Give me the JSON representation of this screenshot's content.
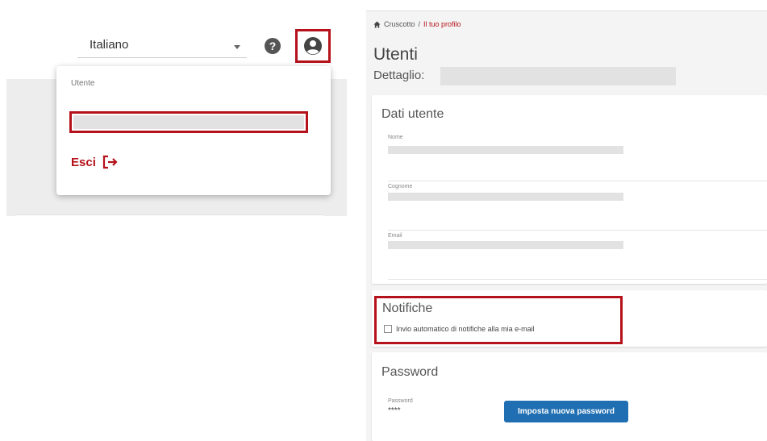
{
  "header": {
    "language": "Italiano",
    "help_icon": "question-circle-icon",
    "user_icon": "user-circle-icon"
  },
  "user_menu": {
    "label": "Utente",
    "logout_label": "Esci",
    "logout_icon": "sign-out-icon"
  },
  "breadcrumb": {
    "home_icon": "home-icon",
    "home": "Cruscotto",
    "separator": "/",
    "current": "Il tuo profilo"
  },
  "page": {
    "title": "Utenti",
    "subtitle_label": "Dettaglio:"
  },
  "user_data": {
    "title": "Dati utente",
    "fields": [
      {
        "label": "Nome"
      },
      {
        "label": "Cognome"
      },
      {
        "label": "Email"
      }
    ]
  },
  "notifications": {
    "title": "Notifiche",
    "checkbox_label": "Invio automatico di notifiche alla mia e-mail",
    "checked": false
  },
  "password": {
    "title": "Password",
    "label": "Password",
    "value": "****",
    "button_label": "Imposta nuova password"
  },
  "colors": {
    "accent": "#b5121b",
    "primary_button": "#1f6fb2",
    "redaction": "#e2e2e2"
  }
}
